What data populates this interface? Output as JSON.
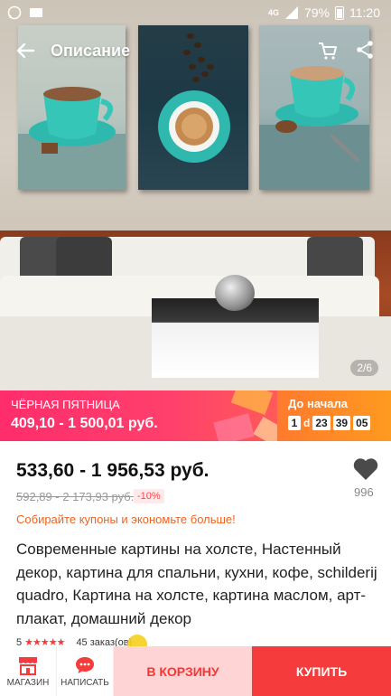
{
  "status_bar": {
    "network": "4G",
    "battery": "79%",
    "time": "11:20"
  },
  "header": {
    "title": "Описание"
  },
  "gallery": {
    "counter": "2/6"
  },
  "promo": {
    "name": "ЧЁРНАЯ ПЯТНИЦА",
    "price": "409,10 - 1 500,01 руб.",
    "countdown_label": "До начала",
    "days": "1",
    "days_unit": "d",
    "hours": "23",
    "minutes": "39",
    "seconds": "05"
  },
  "product": {
    "price": "533,60 - 1 956,53 руб.",
    "old_price": "592,89 - 2 173,93 руб.",
    "discount": "-10%",
    "wishlist_count": "996",
    "coupon_text": "Собирайте купоны и экономьте больше!",
    "description": "Современные картины на холсте, Настенный декор, картина для спальни, кухни, кофе, schilderij quadro, Картина на холсте, картина маслом, арт-плакат, домашний декор",
    "rating_value": "5",
    "stars": "★★★★★",
    "orders": "45 заказ(ов)"
  },
  "bottom_bar": {
    "store_label": "МАГАЗИН",
    "message_label": "НАПИСАТЬ",
    "cart_label": "В КОРЗИНУ",
    "buy_label": "КУПИТЬ"
  },
  "colors": {
    "accent_red": "#f53b3b",
    "promo_pink": "#ff3f6c",
    "promo_orange": "#ff8a24",
    "coupon_orange": "#f0621e"
  }
}
